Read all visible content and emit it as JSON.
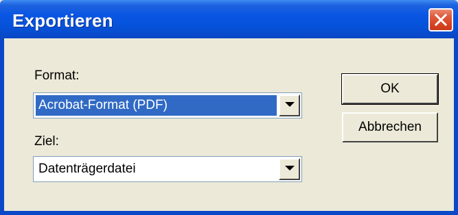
{
  "window": {
    "title": "Exportieren"
  },
  "format": {
    "label": "Format:",
    "value": "Acrobat-Format (PDF)"
  },
  "ziel": {
    "label": "Ziel:",
    "value": "Datenträgerdatei"
  },
  "buttons": {
    "ok": "OK",
    "cancel": "Abbrechen"
  },
  "icons": {
    "close": "close-icon",
    "dropdown": "chevron-down-icon"
  },
  "colors": {
    "titlebar": "#0a56e4",
    "selection": "#316ac5",
    "close": "#d84423",
    "face": "#ece9d8"
  }
}
